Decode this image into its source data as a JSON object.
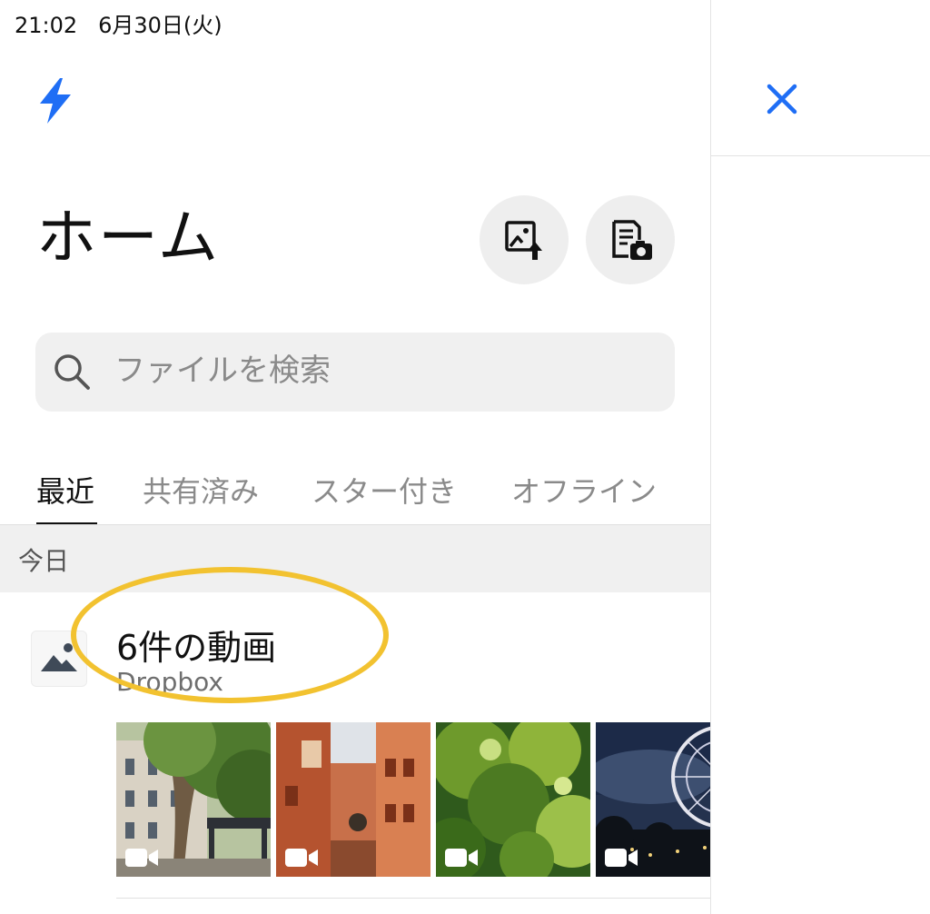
{
  "status_bar": {
    "time": "21:02",
    "date": "6月30日(火)"
  },
  "header": {
    "logo_icon": "lightning-bolt-icon",
    "close_icon": "close-icon",
    "accent_color": "#1f6ef5"
  },
  "page": {
    "title": "ホーム"
  },
  "actions": {
    "upload_photo_icon": "image-upload-icon",
    "scan_document_icon": "document-scan-icon"
  },
  "search": {
    "placeholder": "ファイルを検索",
    "value": ""
  },
  "tabs": [
    {
      "label": "最近",
      "active": true
    },
    {
      "label": "共有済み",
      "active": false
    },
    {
      "label": "スター付き",
      "active": false
    },
    {
      "label": "オフライン",
      "active": false
    }
  ],
  "sections": [
    {
      "label": "今日",
      "items": [
        {
          "icon": "image-icon",
          "title": "6件の動画",
          "subtitle": "Dropbox",
          "thumbnails": [
            {
              "type": "video",
              "scene": "trees-building"
            },
            {
              "type": "video",
              "scene": "red-alley"
            },
            {
              "type": "video",
              "scene": "green-foliage"
            },
            {
              "type": "video",
              "scene": "ferris-wheel-night"
            }
          ]
        }
      ]
    }
  ],
  "annotation": {
    "highlight_color": "#f2c230"
  }
}
